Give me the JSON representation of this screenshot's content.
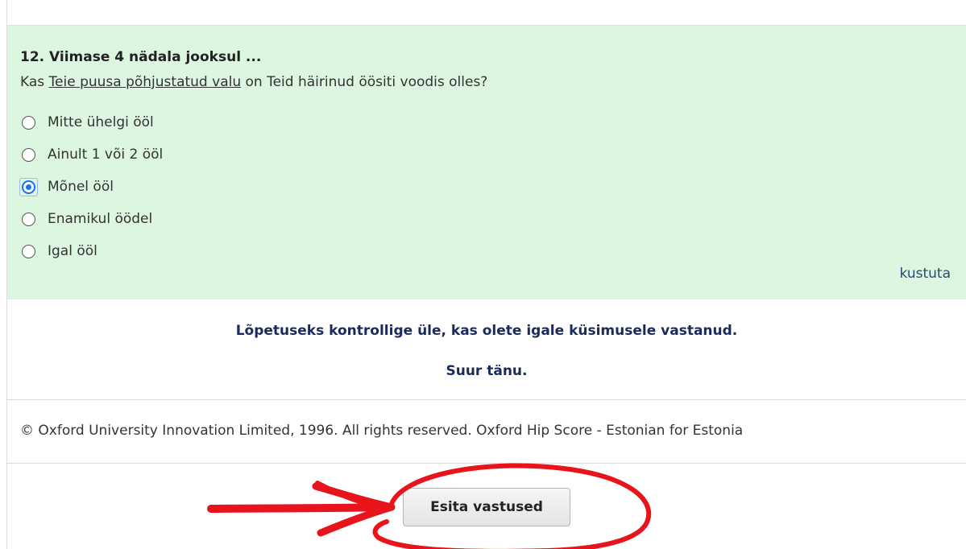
{
  "question": {
    "title": "12. Viimase 4 nädala jooksul ...",
    "text_before": "Kas ",
    "text_underlined": "Teie puusa põhjustatud valu",
    "text_after": " on Teid häirinud öösiti voodis olles?",
    "options": [
      {
        "label": "Mitte ühelgi ööl",
        "selected": false
      },
      {
        "label": "Ainult 1 või 2 ööl",
        "selected": false
      },
      {
        "label": "Mõnel ööl",
        "selected": true
      },
      {
        "label": "Enamikul öödel",
        "selected": false
      },
      {
        "label": "Igal ööl",
        "selected": false
      }
    ],
    "clear_label": "kustuta"
  },
  "closing": {
    "line1": "Lõpetuseks kontrollige üle, kas olete igale küsimusele vastanud.",
    "line2": "Suur tänu."
  },
  "copyright": "© Oxford University Innovation Limited, 1996. All rights reserved. Oxford Hip Score - Estonian for Estonia",
  "submit": {
    "label": "Esita vastused"
  },
  "colors": {
    "panel_background": "#dcf6e0",
    "closing_text": "#1a2a5c",
    "radio_selected": "#1a73e8",
    "annotation_marker": "#e8141b"
  }
}
